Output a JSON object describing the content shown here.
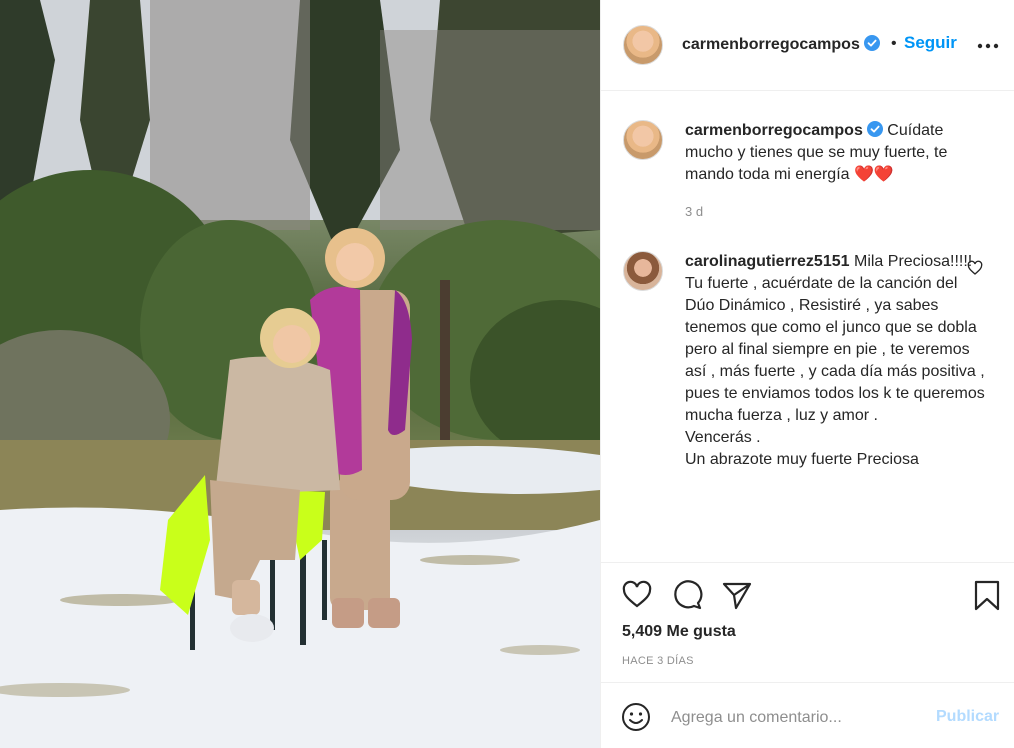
{
  "post": {
    "author": "carmenborregocampos",
    "verified": true,
    "follow_label": "Seguir",
    "separator": "•"
  },
  "caption": {
    "username": "carmenborregocampos",
    "text": "Cuídate mucho y tienes que se muy fuerte, te mando toda mi energía",
    "emoji": "❤️❤️",
    "time": "3 d"
  },
  "comment": {
    "username": "carolinagutierrez5151",
    "lines": [
      "Mila Preciosa!!!!!",
      "Tu fuerte , acuérdate de la canción del Dúo Dinámico , Resistiré , ya sabes tenemos que como el junco que se dobla pero al final siempre en pie , te veremos así , más fuerte , y cada día más positiva , pues te enviamos todos los k te queremos mucha fuerza , luz y amor .",
      "Vencerás .",
      "Un abrazote muy fuerte Preciosa"
    ]
  },
  "actions": {
    "icons": [
      "heart-icon",
      "comment-icon",
      "share-icon",
      "bookmark-icon"
    ],
    "likes": "5,409 Me gusta",
    "date": "HACE 3 DÍAS"
  },
  "composer": {
    "placeholder": "Agrega un comentario...",
    "publish_label": "Publicar"
  },
  "colors": {
    "link": "#0095f6",
    "publish_disabled": "#b3dbff",
    "heart": "#e0245e",
    "secondary_text": "#8e8e8e"
  }
}
